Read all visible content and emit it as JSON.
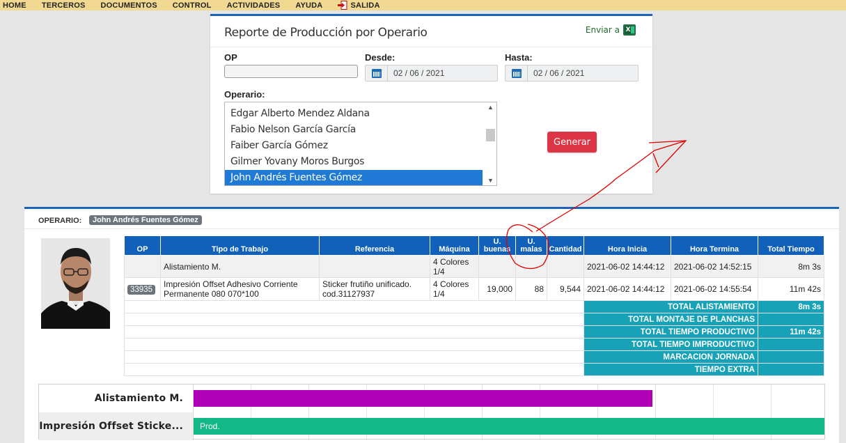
{
  "nav": {
    "items": [
      "HOME",
      "TERCEROS",
      "DOCUMENTOS",
      "CONTROL",
      "ACTIVIDADES",
      "AYUDA"
    ],
    "exit_label": "SALIDA"
  },
  "filter": {
    "title": "Reporte de Producción por Operario",
    "export_label": "Enviar a",
    "op_label": "OP",
    "op_value": "",
    "desde_label": "Desde:",
    "desde_value": "02 / 06 / 2021",
    "hasta_label": "Hasta:",
    "hasta_value": "02 / 06 / 2021",
    "operario_label": "Operario:",
    "operators": [
      "Edgar Alberto Mendez Aldana",
      "Fabio Nelson García García",
      "Faiber García Gómez",
      "Gilmer Yovany Moros Burgos",
      "John Andrés Fuentes Gómez"
    ],
    "selected_operator": "John Andrés Fuentes Gómez",
    "generate_label": "Generar"
  },
  "report": {
    "operator_label": "OPERARIO:",
    "operator_name": "John Andrés Fuentes Gómez",
    "headers": {
      "op": "OP",
      "tipo": "Tipo de Trabajo",
      "referencia": "Referencia",
      "maquina": "Máquina",
      "u_buenas_1": "U.",
      "u_buenas_2": "buenas",
      "u_malas_1": "U.",
      "u_malas_2": "malas",
      "cantidad": "Cantidad",
      "hora_inicia": "Hora Inicia",
      "hora_termina": "Hora Termina",
      "total_tiempo": "Total Tiempo"
    },
    "rows": [
      {
        "op": "",
        "tipo": "Alistamiento M.",
        "referencia": "",
        "maquina": "4 Colores 1/4",
        "u_buenas": "",
        "u_malas": "",
        "cantidad": "",
        "hora_inicia": "2021-06-02 14:44:12",
        "hora_termina": "2021-06-02 14:52:15",
        "total_tiempo": "8m 3s"
      },
      {
        "op": "33935",
        "tipo": "Impresión Offset Adhesivo Corriente Permanente 080 070*100",
        "referencia": "Sticker frutiño unificado. cod.31127937",
        "maquina": "4 Colores 1/4",
        "u_buenas": "19,000",
        "u_malas": "88",
        "cantidad": "9,544",
        "hora_inicia": "2021-06-02 14:44:12",
        "hora_termina": "2021-06-02 14:55:54",
        "total_tiempo": "11m 42s"
      }
    ],
    "totals": [
      {
        "label": "TOTAL ALISTAMIENTO",
        "value": "8m 3s"
      },
      {
        "label": "TOTAL MONTAJE DE PLANCHAS",
        "value": ""
      },
      {
        "label": "TOTAL TIEMPO PRODUCTIVO",
        "value": "11m 42s"
      },
      {
        "label": "TOTAL TIEMPO IMPRODUCTIVO",
        "value": ""
      },
      {
        "label": "MARCACION JORNADA",
        "value": ""
      },
      {
        "label": "TIEMPO EXTRA",
        "value": ""
      }
    ]
  },
  "gantt": {
    "rows": [
      {
        "label": "Alistamiento M.",
        "bar_text": "",
        "color": "#b000b5",
        "start_fraction": 0.0,
        "end_fraction": 0.727
      },
      {
        "label": "Impresión Offset Sticke...",
        "bar_text": "Prod.",
        "color": "#12b886",
        "start_fraction": 0.0,
        "end_fraction": 1.0
      }
    ]
  },
  "colors": {
    "nav_bg": "#f1d991",
    "panel_accent": "#1b64b5",
    "header_blue": "#1160b9",
    "totals_teal": "#17a2b8",
    "generate_red": "#dc3545",
    "selection_blue": "#1f7ad6",
    "annotation_red": "#e00000"
  }
}
